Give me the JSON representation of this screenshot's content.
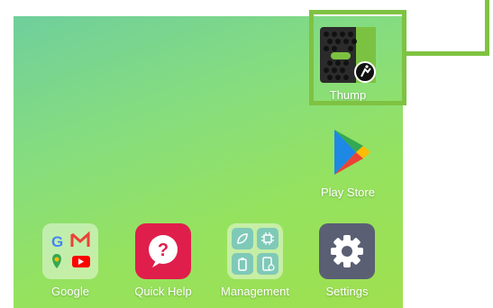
{
  "apps": {
    "thump": {
      "label": "Thump",
      "icon": "thump-speaker-icon"
    },
    "play_store": {
      "label": "Play Store",
      "icon": "play-store-icon"
    },
    "google": {
      "label": "Google",
      "icon": "google-folder-icon"
    },
    "quick_help": {
      "label": "Quick Help",
      "icon": "quick-help-icon"
    },
    "management": {
      "label": "Management",
      "icon": "management-folder-icon"
    },
    "settings": {
      "label": "Settings",
      "icon": "gear-icon"
    }
  },
  "colors": {
    "highlight": "#7fc242",
    "quick_help": "#e01e4b",
    "settings": "#5a5f73"
  }
}
